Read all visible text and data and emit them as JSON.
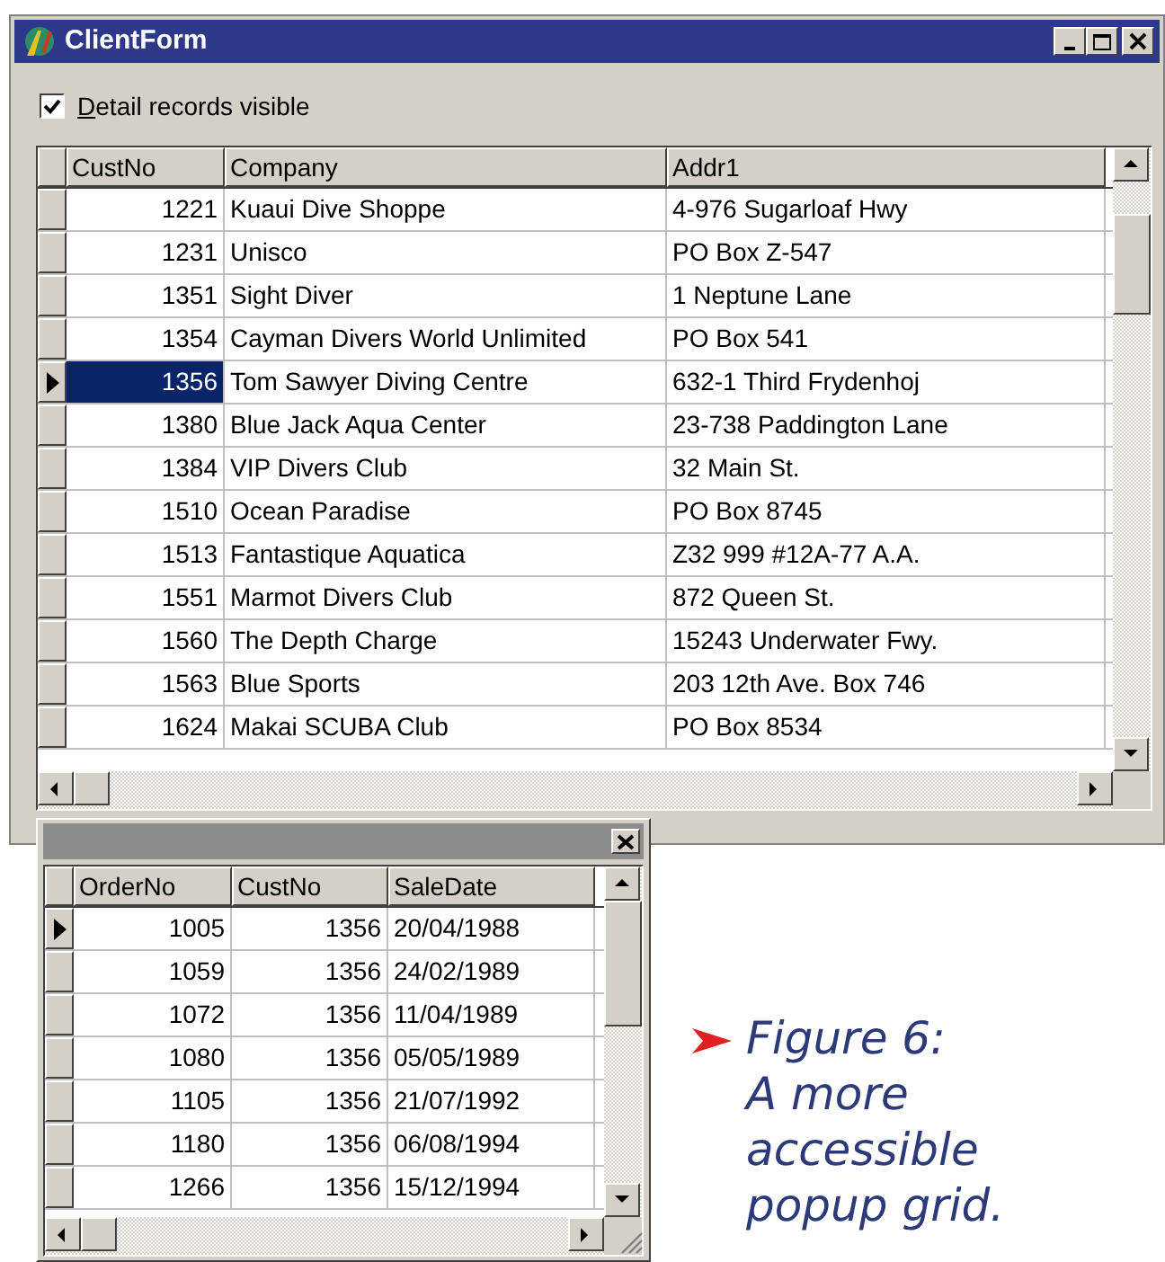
{
  "window": {
    "title": "ClientForm"
  },
  "checkbox": {
    "label": "Detail records visible",
    "checked": true
  },
  "master_grid": {
    "columns": [
      "CustNo",
      "Company",
      "Addr1"
    ],
    "rows": [
      {
        "cells": [
          "1221",
          "Kuaui Dive Shoppe",
          "4-976 Sugarloaf Hwy"
        ],
        "selected": false
      },
      {
        "cells": [
          "1231",
          "Unisco",
          "PO Box Z-547"
        ],
        "selected": false
      },
      {
        "cells": [
          "1351",
          "Sight Diver",
          "1 Neptune Lane"
        ],
        "selected": false
      },
      {
        "cells": [
          "1354",
          "Cayman Divers World Unlimited",
          "PO Box 541"
        ],
        "selected": false
      },
      {
        "cells": [
          "1356",
          "Tom Sawyer Diving Centre",
          "632-1 Third Frydenhoj"
        ],
        "selected": true
      },
      {
        "cells": [
          "1380",
          "Blue Jack Aqua Center",
          "23-738 Paddington Lane"
        ],
        "selected": false
      },
      {
        "cells": [
          "1384",
          "VIP Divers Club",
          "32 Main St."
        ],
        "selected": false
      },
      {
        "cells": [
          "1510",
          "Ocean Paradise",
          "PO Box 8745"
        ],
        "selected": false
      },
      {
        "cells": [
          "1513",
          "Fantastique Aquatica",
          "Z32 999 #12A-77 A.A."
        ],
        "selected": false
      },
      {
        "cells": [
          "1551",
          "Marmot Divers Club",
          "872 Queen St."
        ],
        "selected": false
      },
      {
        "cells": [
          "1560",
          "The Depth Charge",
          "15243 Underwater Fwy."
        ],
        "selected": false
      },
      {
        "cells": [
          "1563",
          "Blue Sports",
          "203 12th Ave. Box 746"
        ],
        "selected": false
      },
      {
        "cells": [
          "1624",
          "Makai SCUBA Club",
          "PO Box 8534"
        ],
        "selected": false
      }
    ]
  },
  "detail_grid": {
    "columns": [
      "OrderNo",
      "CustNo",
      "SaleDate"
    ],
    "rows": [
      {
        "cells": [
          "1005",
          "1356",
          "20/04/1988"
        ],
        "selected": true
      },
      {
        "cells": [
          "1059",
          "1356",
          "24/02/1989"
        ],
        "selected": false
      },
      {
        "cells": [
          "1072",
          "1356",
          "11/04/1989"
        ],
        "selected": false
      },
      {
        "cells": [
          "1080",
          "1356",
          "05/05/1989"
        ],
        "selected": false
      },
      {
        "cells": [
          "1105",
          "1356",
          "21/07/1992"
        ],
        "selected": false
      },
      {
        "cells": [
          "1180",
          "1356",
          "06/08/1994"
        ],
        "selected": false
      },
      {
        "cells": [
          "1266",
          "1356",
          "15/12/1994"
        ],
        "selected": false
      }
    ]
  },
  "caption": {
    "lines": [
      "Figure 6:",
      "A more",
      "accessible",
      "popup grid."
    ]
  }
}
